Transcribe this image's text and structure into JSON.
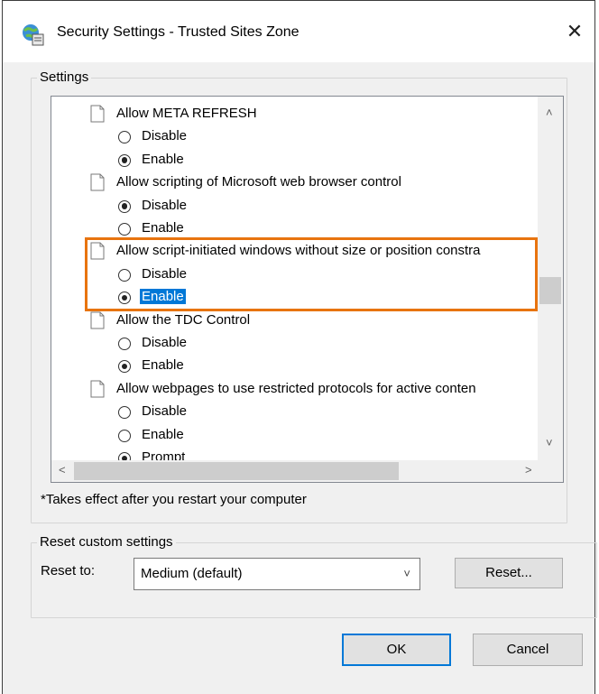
{
  "window": {
    "title": "Security Settings - Trusted Sites Zone",
    "close_glyph": "✕"
  },
  "settings_group": {
    "label": "Settings"
  },
  "list_items": [
    {
      "kind": "header",
      "label": "Allow META REFRESH"
    },
    {
      "kind": "option",
      "label": "Disable",
      "checked": false
    },
    {
      "kind": "option",
      "label": "Enable",
      "checked": true
    },
    {
      "kind": "header",
      "label": "Allow scripting of Microsoft web browser control"
    },
    {
      "kind": "option",
      "label": "Disable",
      "checked": true
    },
    {
      "kind": "option",
      "label": "Enable",
      "checked": false
    },
    {
      "kind": "header",
      "label": "Allow script-initiated windows without size or position constra"
    },
    {
      "kind": "option",
      "label": "Disable",
      "checked": false
    },
    {
      "kind": "option",
      "label": "Enable",
      "checked": true,
      "selected": true
    },
    {
      "kind": "header",
      "label": "Allow the TDC Control"
    },
    {
      "kind": "option",
      "label": "Disable",
      "checked": false
    },
    {
      "kind": "option",
      "label": "Enable",
      "checked": true
    },
    {
      "kind": "header",
      "label": "Allow webpages to use restricted protocols for active conten"
    },
    {
      "kind": "option",
      "label": "Disable",
      "checked": false
    },
    {
      "kind": "option",
      "label": "Enable",
      "checked": false
    },
    {
      "kind": "option",
      "label": "Prompt",
      "checked": true
    }
  ],
  "note": "*Takes effect after you restart your computer",
  "reset_group": {
    "label": "Reset custom settings",
    "reset_to_label": "Reset to:",
    "select_value": "Medium (default)",
    "reset_button": "Reset..."
  },
  "buttons": {
    "ok": "OK",
    "cancel": "Cancel"
  },
  "colors": {
    "highlight": "#0078d7",
    "annotation_box": "#e8740f"
  }
}
